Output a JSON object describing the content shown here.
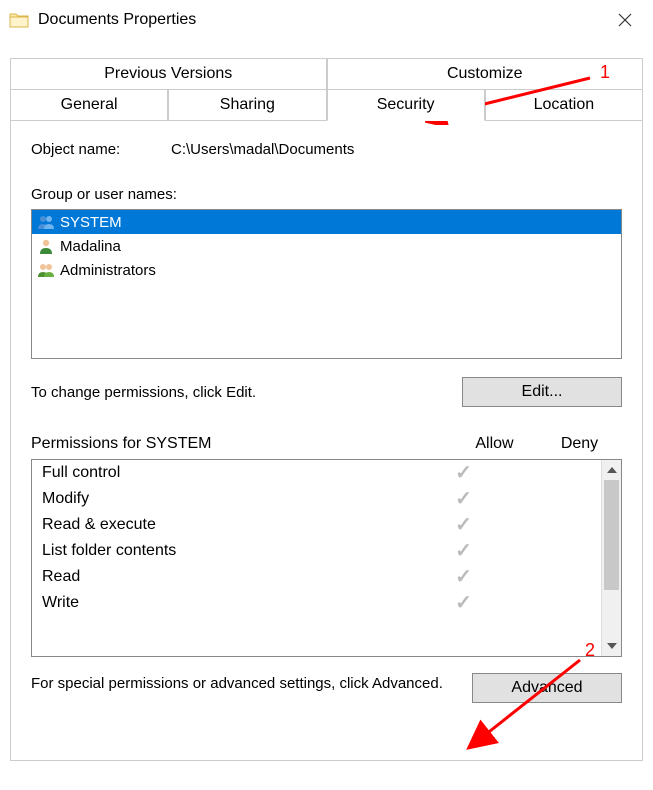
{
  "titlebar": {
    "title": "Documents Properties"
  },
  "tabs": {
    "row1": [
      {
        "label": "Previous Versions"
      },
      {
        "label": "Customize"
      }
    ],
    "row2": [
      {
        "label": "General"
      },
      {
        "label": "Sharing"
      },
      {
        "label": "Security",
        "active": true
      },
      {
        "label": "Location"
      }
    ]
  },
  "object": {
    "label": "Object name:",
    "value": "C:\\Users\\madal\\Documents"
  },
  "groups": {
    "label": "Group or user names:",
    "items": [
      {
        "icon": "users",
        "name": "SYSTEM",
        "selected": true
      },
      {
        "icon": "user",
        "name": "Madalina",
        "selected": false
      },
      {
        "icon": "users",
        "name": "Administrators",
        "selected": false
      }
    ]
  },
  "edit": {
    "text": "To change permissions, click Edit.",
    "button": "Edit..."
  },
  "permissions": {
    "title": "Permissions for SYSTEM",
    "allow_label": "Allow",
    "deny_label": "Deny",
    "rows": [
      {
        "name": "Full control",
        "allow": true,
        "deny": false
      },
      {
        "name": "Modify",
        "allow": true,
        "deny": false
      },
      {
        "name": "Read & execute",
        "allow": true,
        "deny": false
      },
      {
        "name": "List folder contents",
        "allow": true,
        "deny": false
      },
      {
        "name": "Read",
        "allow": true,
        "deny": false
      },
      {
        "name": "Write",
        "allow": true,
        "deny": false
      }
    ]
  },
  "advanced": {
    "text": "For special permissions or advanced settings, click Advanced.",
    "button": "Advanced"
  },
  "annotations": {
    "a1": "1",
    "a2": "2"
  }
}
